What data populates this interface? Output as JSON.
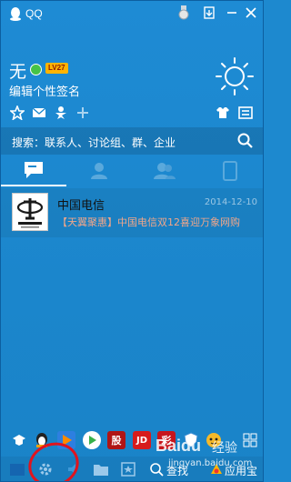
{
  "window": {
    "title": "QQ",
    "accent": "#1d89cf"
  },
  "profile": {
    "nickname": "无",
    "level": "LV27",
    "signature": "编辑个性签名"
  },
  "search": {
    "placeholder": "搜索：联系人、讨论组、群、企业"
  },
  "tabs": [
    {
      "icon": "chat-icon",
      "active": true
    },
    {
      "icon": "contacts-icon"
    },
    {
      "icon": "groups-icon"
    },
    {
      "icon": "phone-icon"
    }
  ],
  "messages": [
    {
      "name": "中国电信",
      "time": "2014-12-10",
      "preview": "【天翼聚惠】中国电信双12喜迎万象网购"
    }
  ],
  "bottom": {
    "find_label": "查找",
    "apps_label": "应用宝"
  },
  "watermark": {
    "brand": "Baidu",
    "text": "经验",
    "site": "jingyan.baidu.com"
  }
}
